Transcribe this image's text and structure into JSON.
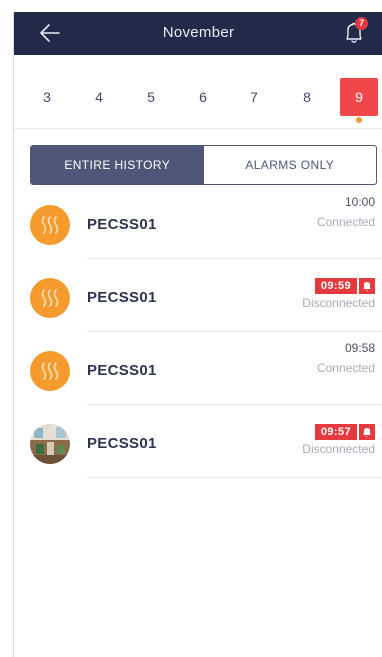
{
  "header": {
    "title": "November",
    "notification_count": "7",
    "colors": {
      "bar": "#222a4a",
      "badge": "#e8383f"
    }
  },
  "days": [
    {
      "label": "3"
    },
    {
      "label": "4"
    },
    {
      "label": "5"
    },
    {
      "label": "6"
    },
    {
      "label": "7"
    },
    {
      "label": "8"
    },
    {
      "label": "9",
      "selected": true
    }
  ],
  "filter": {
    "entire_label": "ENTIRE HISTORY",
    "alarms_label": "ALARMS ONLY",
    "selected": "entire"
  },
  "events": [
    {
      "device": "PECSS01",
      "time": "10:00",
      "status": "Connected",
      "alarm": false,
      "avatar": "heater-icon"
    },
    {
      "device": "PECSS01",
      "time": "09:59",
      "status": "Disconnected",
      "alarm": true,
      "avatar": "heater-icon"
    },
    {
      "device": "PECSS01",
      "time": "09:58",
      "status": "Connected",
      "alarm": false,
      "avatar": "heater-icon"
    },
    {
      "device": "PECSS01",
      "time": "09:57",
      "status": "Disconnected",
      "alarm": true,
      "avatar": "room-photo"
    }
  ],
  "colors": {
    "accent": "#f2474a",
    "avatar": "#f59a2d",
    "segment": "#4e5778"
  }
}
